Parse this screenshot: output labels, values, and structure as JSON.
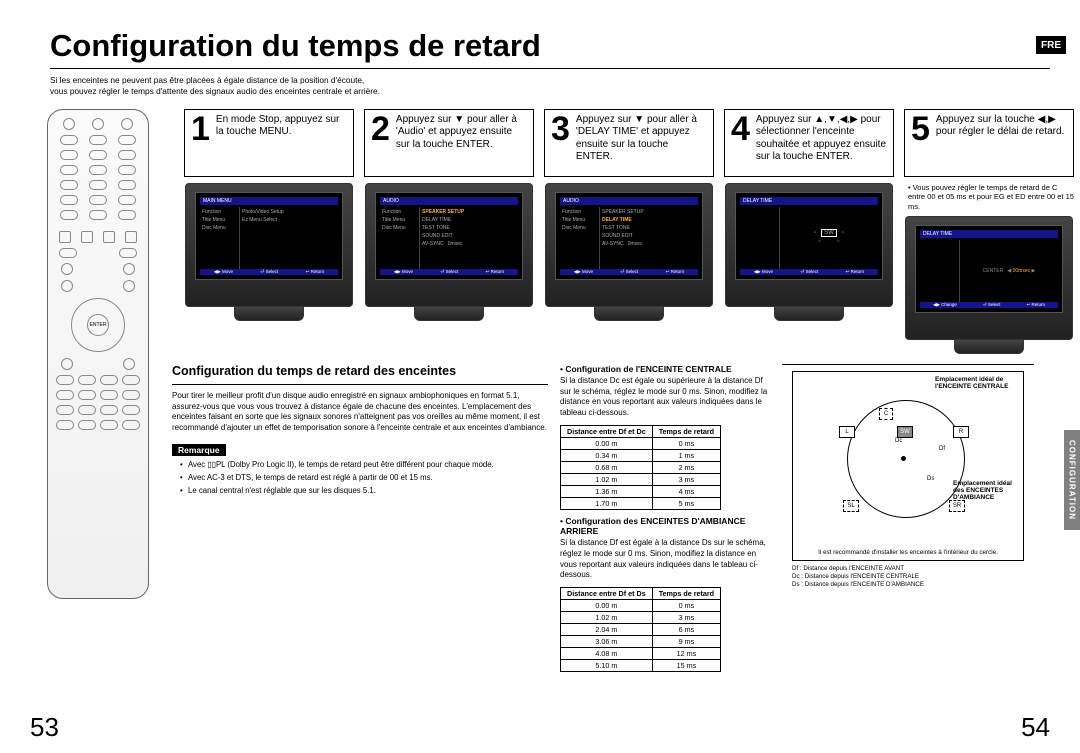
{
  "lang_badge": "FRE",
  "title": "Configuration du temps de retard",
  "intro_line1": "Si les enceintes ne peuvent pas être placées à égale distance de la position d'écoute,",
  "intro_line2": "vous pouvez régler le temps d'attente des signaux audio des enceintes centrale et arrière.",
  "side_tab": "CONFIGURATION",
  "steps": [
    {
      "num": "1",
      "text": "En mode Stop, appuyez sur la touche MENU."
    },
    {
      "num": "2",
      "text": "Appuyez sur ▼ pour aller à 'Audio' et appuyez ensuite sur la touche ENTER."
    },
    {
      "num": "3",
      "text": "Appuyez sur ▼ pour aller à 'DELAY TIME' et appuyez ensuite sur la touche ENTER."
    },
    {
      "num": "4",
      "text": "Appuyez sur ▲,▼,◀,▶ pour sélectionner l'enceinte souhaitée et appuyez ensuite sur la touche ENTER."
    },
    {
      "num": "5",
      "text": "Appuyez sur la touche ◀,▶ pour régler le délai de retard."
    }
  ],
  "step5_note": "• Vous pouvez régler le temps de retard de C entre 00 et 05 ms et pour EG et ED entre 00 et 15 ms.",
  "tv_headers": [
    "MAIN MENU",
    "AUDIO",
    "AUDIO",
    "DELAY TIME",
    "DELAY TIME"
  ],
  "section_title": "Configuration du temps de retard des enceintes",
  "section_para": "Pour tirer le meilleur profit d'un disque audio enregistré en signaux ambiophoniques en format 5.1, assurez-vous que vous vous trouvez à distance égale de chacune des enceintes. L'emplacement des enceintes faisant en sorte que les signaux sonores n'atteignent pas vos oreilles au même moment, il est recommandé d'ajouter un effet de temporisation sonore à l'enceinte centrale et aux enceintes d'ambiance.",
  "remark_label": "Remarque",
  "remarks": [
    "Avec ▯▯PL (Dolby Pro Logic II), le temps de retard peut être différent pour chaque mode.",
    "Avec AC-3 et DTS, le temps de retard est réglé à partir de 00 et 15 ms.",
    "Le canal central n'est réglable que sur les disques 5.1."
  ],
  "center_heading": "• Configuration de l'ENCEINTE CENTRALE",
  "center_para": "Si la distance Dc est égale ou supérieure à la distance Df sur le schéma, réglez le mode sur 0 ms. Sinon, modifiez la distance en vous reportant aux valeurs indiquées dans le tableau ci-dessous.",
  "table1": {
    "head": [
      "Distance entre Df et Dc",
      "Temps de retard"
    ],
    "rows": [
      [
        "0.00 m",
        "0 ms"
      ],
      [
        "0.34 m",
        "1 ms"
      ],
      [
        "0.68 m",
        "2 ms"
      ],
      [
        "1.02 m",
        "3 ms"
      ],
      [
        "1.36 m",
        "4 ms"
      ],
      [
        "1.70 m",
        "5 ms"
      ]
    ]
  },
  "rear_heading": "• Configuration des ENCEINTES D'AMBIANCE ARRIERE",
  "rear_para": "Si la distance Df est égale à la distance Ds sur le schéma, réglez le mode sur 0 ms. Sinon, modifiez la distance en vous reportant aux valeurs indiquées dans le tableau ci-dessous.",
  "table2": {
    "head": [
      "Distance entre Df et Ds",
      "Temps de retard"
    ],
    "rows": [
      [
        "0.00 m",
        "0 ms"
      ],
      [
        "1.02 m",
        "3 ms"
      ],
      [
        "2.04 m",
        "6 ms"
      ],
      [
        "3.06 m",
        "9 ms"
      ],
      [
        "4.08 m",
        "12 ms"
      ],
      [
        "5.10 m",
        "15 ms"
      ]
    ]
  },
  "diagram": {
    "label_center_top": "Emplacement idéal de l'ENCEINTE CENTRALE",
    "label_surround": "Emplacement idéal des ENCEINTES D'AMBIANCE",
    "caption": "Il est recommandé d'installer les enceintes à l'intérieur du cercle.",
    "legend": [
      "Df : Distance depuis l'ENCEINTE AVANT",
      "Dc : Distance depuis l'ENCEINTE CENTRALE",
      "Ds : Distance depuis l'ENCEINTE D'AMBIANCE"
    ],
    "speakers": {
      "L": "L",
      "C": "C",
      "SW": "SW",
      "R": "R",
      "SL": "SL",
      "SR": "SR"
    }
  },
  "page_left": "53",
  "page_right": "54"
}
